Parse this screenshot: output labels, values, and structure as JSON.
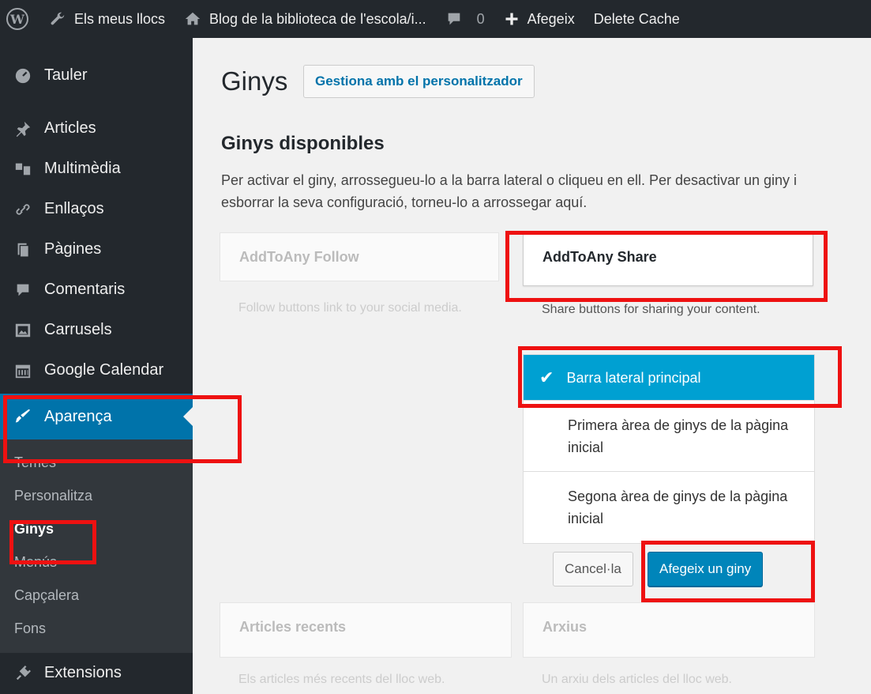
{
  "adminbar": {
    "my_sites": "Els meus llocs",
    "site_name": "Blog de la biblioteca de l'escola/i...",
    "comments_count": "0",
    "add_new": "Afegeix",
    "delete_cache": "Delete Cache"
  },
  "sidebar": {
    "items": [
      {
        "label": "Tauler",
        "icon": "dashboard-icon"
      },
      {
        "label": "Articles",
        "icon": "pin-icon"
      },
      {
        "label": "Multimèdia",
        "icon": "media-icon"
      },
      {
        "label": "Enllaços",
        "icon": "link-icon"
      },
      {
        "label": "Pàgines",
        "icon": "pages-icon"
      },
      {
        "label": "Comentaris",
        "icon": "comment-icon"
      },
      {
        "label": "Carrusels",
        "icon": "image-icon"
      },
      {
        "label": "Google Calendar",
        "icon": "calendar-icon"
      },
      {
        "label": "Aparença",
        "icon": "brush-icon"
      },
      {
        "label": "Extensions",
        "icon": "plugin-icon"
      }
    ],
    "submenu": [
      "Temes",
      "Personalitza",
      "Ginys",
      "Menús",
      "Capçalera",
      "Fons"
    ]
  },
  "main": {
    "title": "Ginys",
    "title_action": "Gestiona amb el personalitzador",
    "section_title": "Ginys disponibles",
    "description": "Per activar el giny, arrossegueu-lo a la barra lateral o cliqueu en ell. Per desactivar un giny i esborrar la seva configuració, torneu-lo a arrossegar aquí.",
    "widgets": [
      {
        "title": "AddToAny Follow",
        "desc": "Follow buttons link to your social media."
      },
      {
        "title": "AddToAny Share",
        "desc": "Share buttons for sharing your content."
      },
      {
        "title": "Articles recents",
        "desc": "Els articles més recents del lloc web."
      },
      {
        "title": "Arxius",
        "desc": "Un arxiu dels articles del lloc web."
      }
    ],
    "chooser": [
      "Barra lateral principal",
      "Primera àrea de ginys de la pàgina inicial",
      "Segona àrea de ginys de la pàgina inicial"
    ],
    "cancel": "Cancel·la",
    "add_widget": "Afegeix un giny"
  },
  "colors": {
    "admin_dark": "#23282d",
    "accent": "#0073aa",
    "selected": "#00a0d2",
    "highlight": "#ee1111"
  }
}
